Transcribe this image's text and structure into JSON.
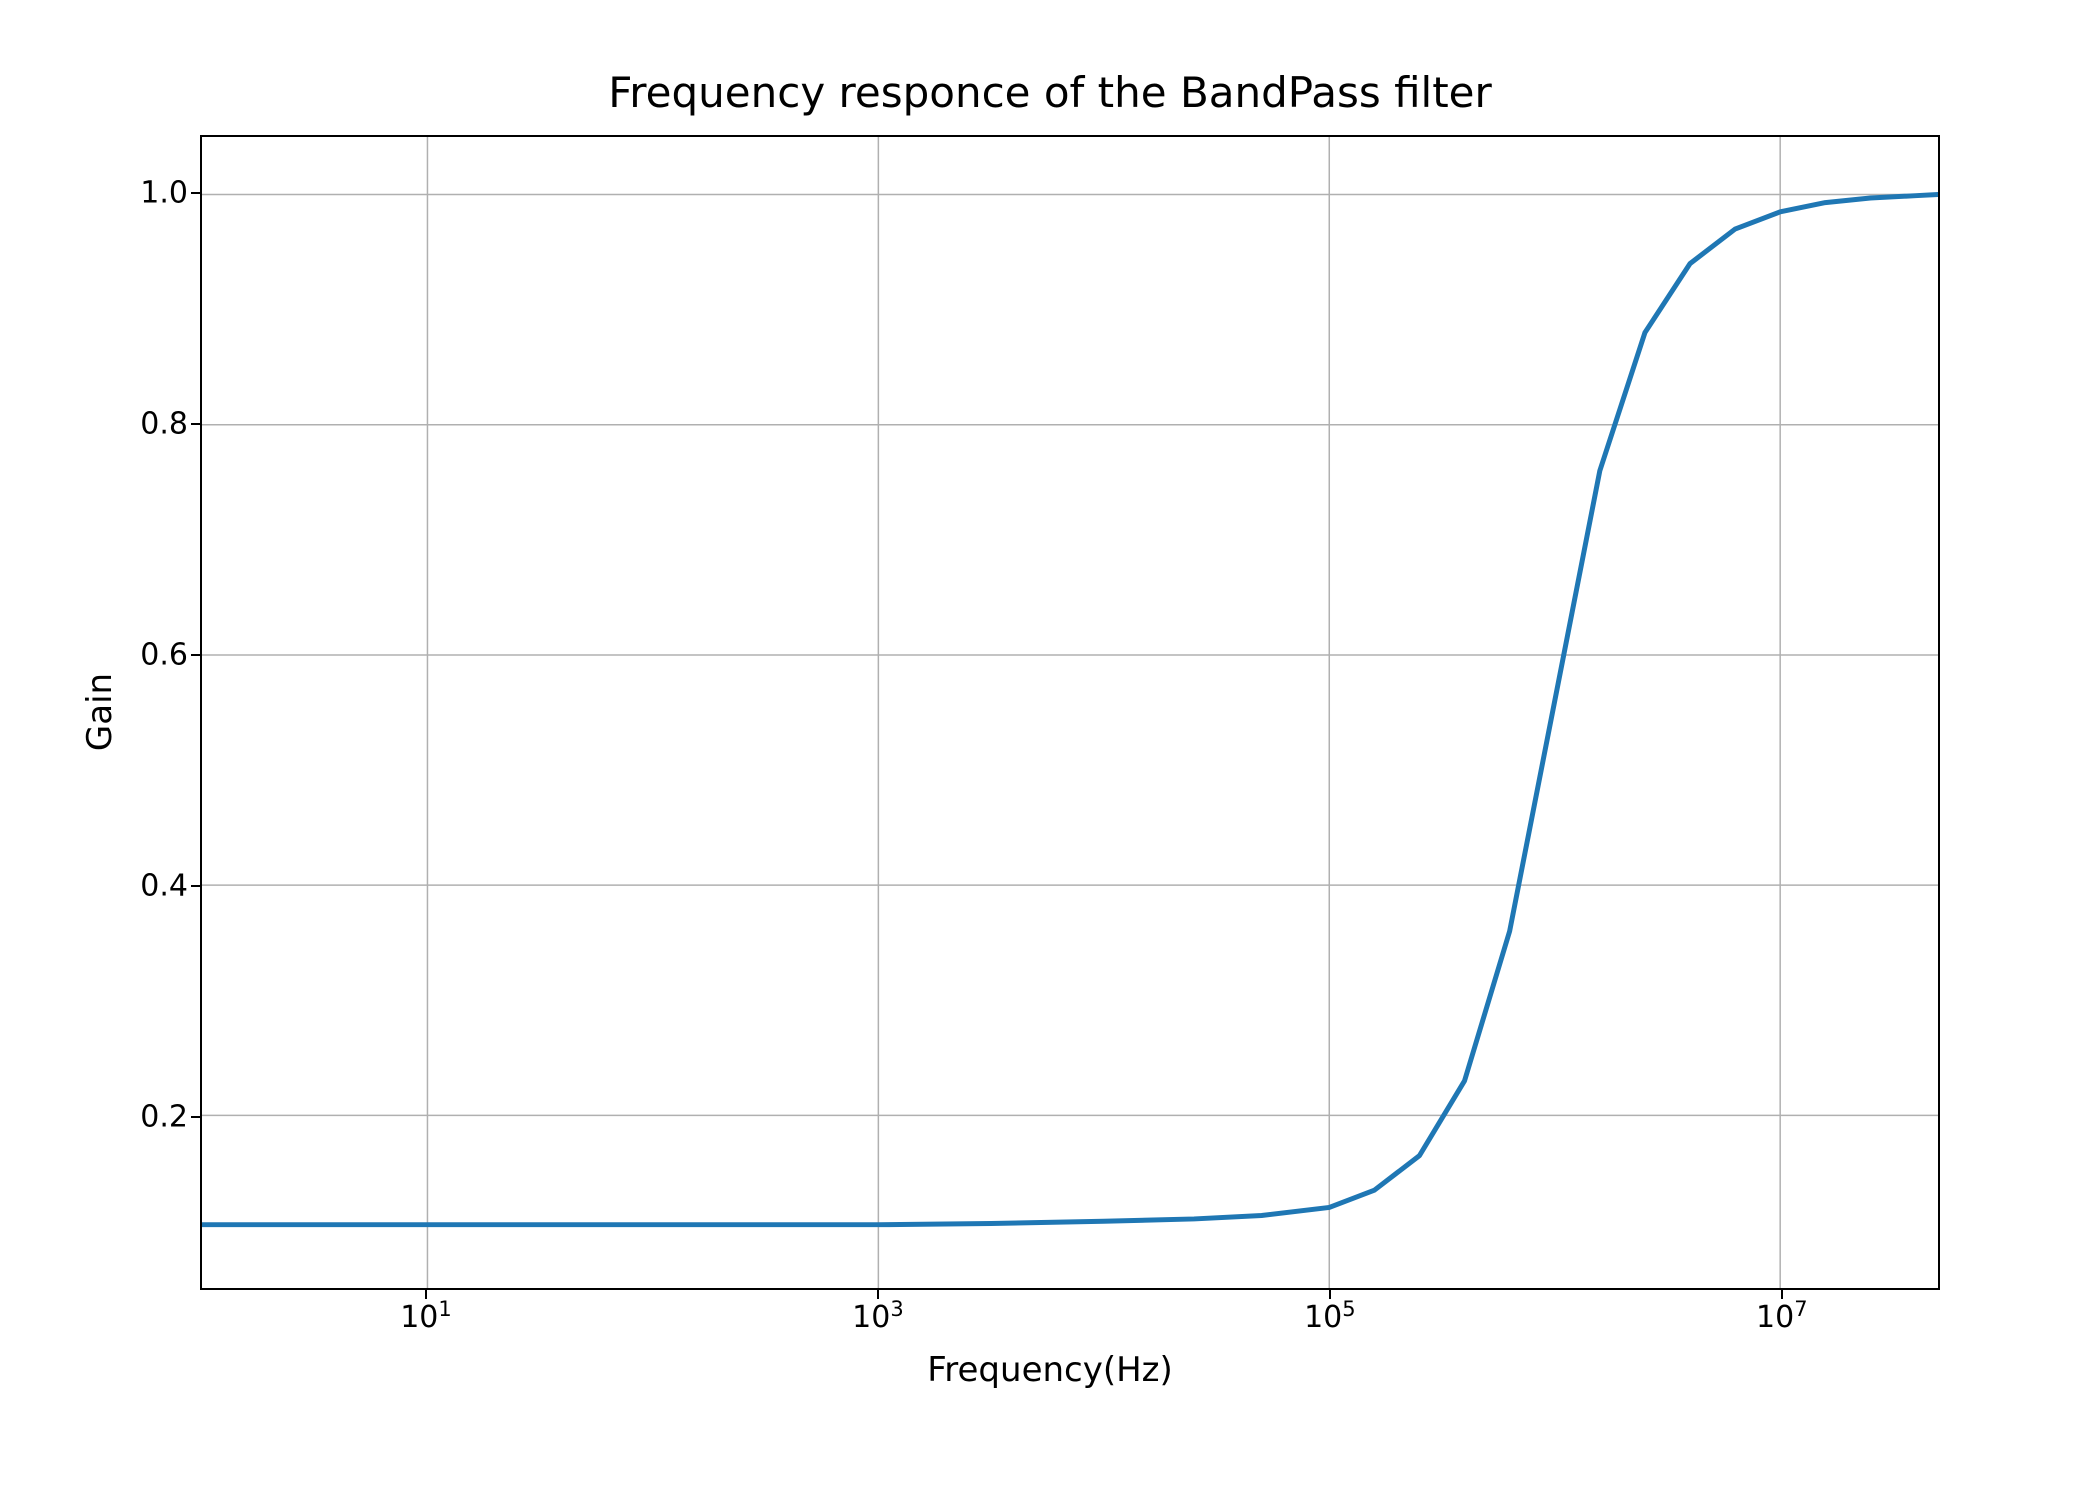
{
  "chart_data": {
    "type": "line",
    "title": "Frequency responce of the BandPass filter",
    "xlabel": "Frequency(Hz)",
    "ylabel": "Gain",
    "x_scale": "log",
    "xlim_log10": [
      0.0,
      7.7
    ],
    "ylim": [
      0.05,
      1.05
    ],
    "grid": true,
    "x_ticks": [
      {
        "log10": 1,
        "label_base": "10",
        "label_exp": "1"
      },
      {
        "log10": 3,
        "label_base": "10",
        "label_exp": "3"
      },
      {
        "log10": 5,
        "label_base": "10",
        "label_exp": "5"
      },
      {
        "log10": 7,
        "label_base": "10",
        "label_exp": "7"
      }
    ],
    "y_ticks": [
      0.2,
      0.4,
      0.6,
      0.8,
      1.0
    ],
    "series": [
      {
        "name": "gain",
        "color": "#1f77b4",
        "x_log10": [
          0.0,
          1.0,
          2.0,
          3.0,
          3.5,
          4.0,
          4.4,
          4.7,
          5.0,
          5.2,
          5.4,
          5.6,
          5.8,
          6.0,
          6.2,
          6.4,
          6.6,
          6.8,
          7.0,
          7.2,
          7.4,
          7.6,
          7.7
        ],
        "y": [
          0.105,
          0.105,
          0.105,
          0.105,
          0.106,
          0.108,
          0.11,
          0.113,
          0.12,
          0.135,
          0.165,
          0.23,
          0.36,
          0.56,
          0.76,
          0.88,
          0.94,
          0.97,
          0.985,
          0.993,
          0.997,
          0.999,
          1.0
        ]
      }
    ]
  }
}
